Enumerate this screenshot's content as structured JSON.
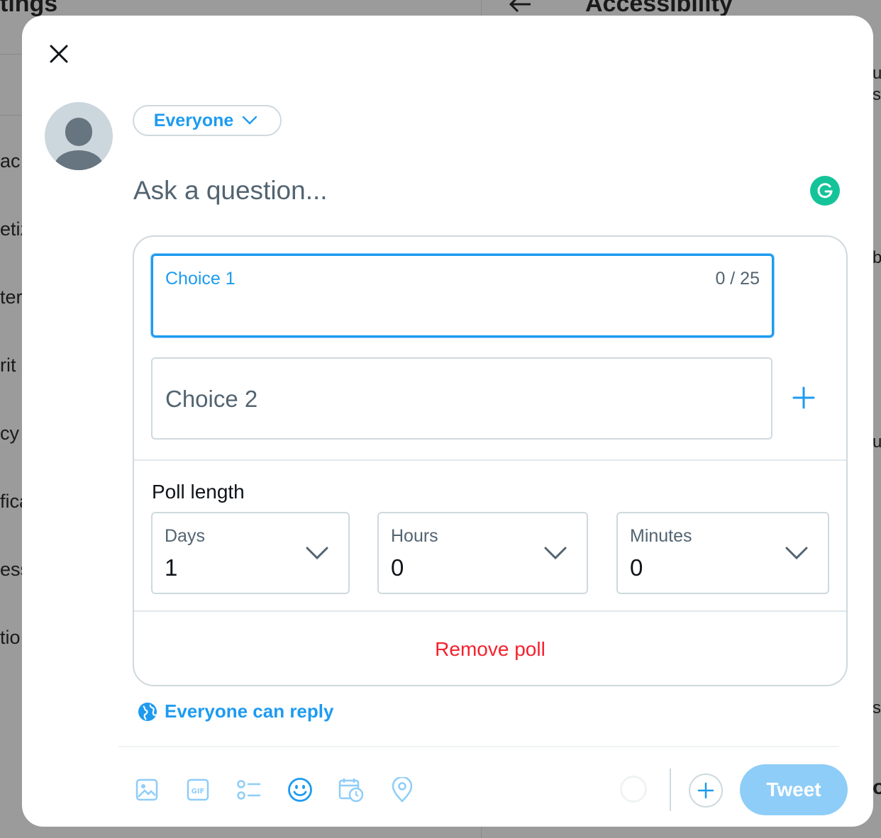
{
  "background": {
    "left_heading": "tings",
    "right_heading": "Accessibility",
    "left_fragments": [
      "ac",
      "etiz",
      "ter",
      "rit",
      "cy",
      "fica",
      "ess",
      "tio"
    ],
    "right_fragments": [
      "u",
      "s",
      "b",
      "u",
      "s",
      "oi"
    ]
  },
  "composer": {
    "audience_label": "Everyone",
    "question_placeholder": "Ask a question...",
    "poll": {
      "choice1_label": "Choice 1",
      "choice1_counter": "0 / 25",
      "choice2_label": "Choice 2",
      "poll_length_title": "Poll length",
      "days_label": "Days",
      "days_value": "1",
      "hours_label": "Hours",
      "hours_value": "0",
      "minutes_label": "Minutes",
      "minutes_value": "0",
      "remove_label": "Remove poll"
    },
    "reply_setting": "Everyone can reply",
    "tweet_button": "Tweet"
  },
  "icons": {
    "close": "close-icon",
    "media": "image-icon",
    "gif": "gif-icon",
    "poll": "poll-icon",
    "emoji": "emoji-icon",
    "schedule": "schedule-icon",
    "location": "location-icon",
    "add": "plus-icon",
    "globe": "globe-icon",
    "grammarly": "grammarly-icon"
  },
  "colors": {
    "accent": "#1d9bf0",
    "danger": "#f4212e",
    "tweet_disabled": "#8ecdf8",
    "grammarly": "#15c39a"
  }
}
